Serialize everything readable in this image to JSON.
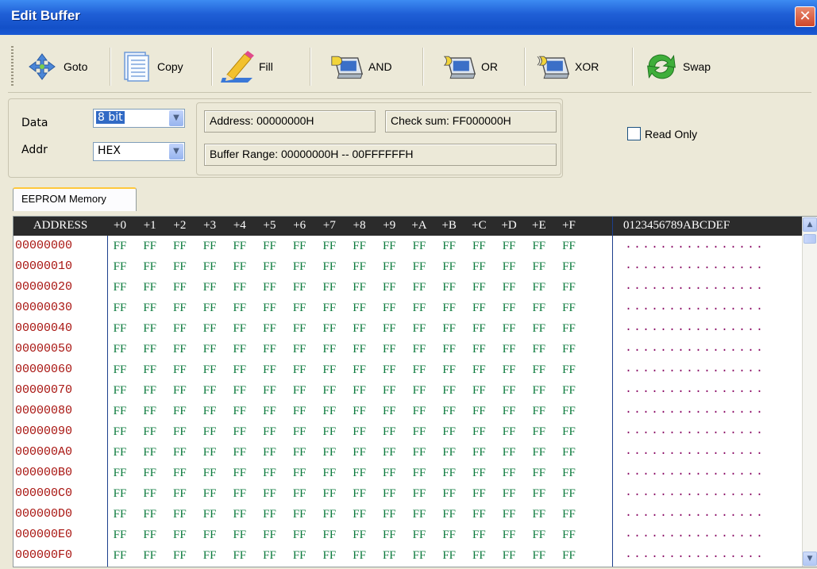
{
  "window": {
    "title": "Edit Buffer",
    "close_glyph": "✕"
  },
  "toolbar": {
    "buttons": [
      {
        "label": "Goto",
        "icon": "goto-arrows-icon"
      },
      {
        "label": "Copy",
        "icon": "copy-document-icon"
      },
      {
        "label": "Fill",
        "icon": "fill-pencil-icon"
      },
      {
        "label": "AND",
        "icon": "and-gate-icon"
      },
      {
        "label": "OR",
        "icon": "or-gate-icon"
      },
      {
        "label": "XOR",
        "icon": "xor-gate-icon"
      },
      {
        "label": "Swap",
        "icon": "swap-arrows-icon"
      }
    ]
  },
  "settings": {
    "data_label": "Data",
    "data_value": "8 bit",
    "addr_label": "Addr",
    "addr_value": "HEX",
    "address": "Address: 00000000H",
    "checksum": "Check sum: FF000000H",
    "buffer_range": "Buffer Range: 00000000H -- 00FFFFFFH",
    "read_only_label": "Read Only",
    "read_only_checked": false
  },
  "tab": {
    "label": "EEPROM Memory"
  },
  "grid": {
    "header_address": "ADDRESS",
    "columns": [
      "+0",
      "+1",
      "+2",
      "+3",
      "+4",
      "+5",
      "+6",
      "+7",
      "+8",
      "+9",
      "+A",
      "+B",
      "+C",
      "+D",
      "+E",
      "+F"
    ],
    "header_ascii": "0123456789ABCDEF",
    "rows": [
      {
        "address": "00000000",
        "bytes": [
          "FF",
          "FF",
          "FF",
          "FF",
          "FF",
          "FF",
          "FF",
          "FF",
          "FF",
          "FF",
          "FF",
          "FF",
          "FF",
          "FF",
          "FF",
          "FF"
        ],
        "ascii": "................"
      },
      {
        "address": "00000010",
        "bytes": [
          "FF",
          "FF",
          "FF",
          "FF",
          "FF",
          "FF",
          "FF",
          "FF",
          "FF",
          "FF",
          "FF",
          "FF",
          "FF",
          "FF",
          "FF",
          "FF"
        ],
        "ascii": "................"
      },
      {
        "address": "00000020",
        "bytes": [
          "FF",
          "FF",
          "FF",
          "FF",
          "FF",
          "FF",
          "FF",
          "FF",
          "FF",
          "FF",
          "FF",
          "FF",
          "FF",
          "FF",
          "FF",
          "FF"
        ],
        "ascii": "................"
      },
      {
        "address": "00000030",
        "bytes": [
          "FF",
          "FF",
          "FF",
          "FF",
          "FF",
          "FF",
          "FF",
          "FF",
          "FF",
          "FF",
          "FF",
          "FF",
          "FF",
          "FF",
          "FF",
          "FF"
        ],
        "ascii": "................"
      },
      {
        "address": "00000040",
        "bytes": [
          "FF",
          "FF",
          "FF",
          "FF",
          "FF",
          "FF",
          "FF",
          "FF",
          "FF",
          "FF",
          "FF",
          "FF",
          "FF",
          "FF",
          "FF",
          "FF"
        ],
        "ascii": "................"
      },
      {
        "address": "00000050",
        "bytes": [
          "FF",
          "FF",
          "FF",
          "FF",
          "FF",
          "FF",
          "FF",
          "FF",
          "FF",
          "FF",
          "FF",
          "FF",
          "FF",
          "FF",
          "FF",
          "FF"
        ],
        "ascii": "................"
      },
      {
        "address": "00000060",
        "bytes": [
          "FF",
          "FF",
          "FF",
          "FF",
          "FF",
          "FF",
          "FF",
          "FF",
          "FF",
          "FF",
          "FF",
          "FF",
          "FF",
          "FF",
          "FF",
          "FF"
        ],
        "ascii": "................"
      },
      {
        "address": "00000070",
        "bytes": [
          "FF",
          "FF",
          "FF",
          "FF",
          "FF",
          "FF",
          "FF",
          "FF",
          "FF",
          "FF",
          "FF",
          "FF",
          "FF",
          "FF",
          "FF",
          "FF"
        ],
        "ascii": "................"
      },
      {
        "address": "00000080",
        "bytes": [
          "FF",
          "FF",
          "FF",
          "FF",
          "FF",
          "FF",
          "FF",
          "FF",
          "FF",
          "FF",
          "FF",
          "FF",
          "FF",
          "FF",
          "FF",
          "FF"
        ],
        "ascii": "................"
      },
      {
        "address": "00000090",
        "bytes": [
          "FF",
          "FF",
          "FF",
          "FF",
          "FF",
          "FF",
          "FF",
          "FF",
          "FF",
          "FF",
          "FF",
          "FF",
          "FF",
          "FF",
          "FF",
          "FF"
        ],
        "ascii": "................"
      },
      {
        "address": "000000A0",
        "bytes": [
          "FF",
          "FF",
          "FF",
          "FF",
          "FF",
          "FF",
          "FF",
          "FF",
          "FF",
          "FF",
          "FF",
          "FF",
          "FF",
          "FF",
          "FF",
          "FF"
        ],
        "ascii": "................"
      },
      {
        "address": "000000B0",
        "bytes": [
          "FF",
          "FF",
          "FF",
          "FF",
          "FF",
          "FF",
          "FF",
          "FF",
          "FF",
          "FF",
          "FF",
          "FF",
          "FF",
          "FF",
          "FF",
          "FF"
        ],
        "ascii": "................"
      },
      {
        "address": "000000C0",
        "bytes": [
          "FF",
          "FF",
          "FF",
          "FF",
          "FF",
          "FF",
          "FF",
          "FF",
          "FF",
          "FF",
          "FF",
          "FF",
          "FF",
          "FF",
          "FF",
          "FF"
        ],
        "ascii": "................"
      },
      {
        "address": "000000D0",
        "bytes": [
          "FF",
          "FF",
          "FF",
          "FF",
          "FF",
          "FF",
          "FF",
          "FF",
          "FF",
          "FF",
          "FF",
          "FF",
          "FF",
          "FF",
          "FF",
          "FF"
        ],
        "ascii": "................"
      },
      {
        "address": "000000E0",
        "bytes": [
          "FF",
          "FF",
          "FF",
          "FF",
          "FF",
          "FF",
          "FF",
          "FF",
          "FF",
          "FF",
          "FF",
          "FF",
          "FF",
          "FF",
          "FF",
          "FF"
        ],
        "ascii": "................"
      },
      {
        "address": "000000F0",
        "bytes": [
          "FF",
          "FF",
          "FF",
          "FF",
          "FF",
          "FF",
          "FF",
          "FF",
          "FF",
          "FF",
          "FF",
          "FF",
          "FF",
          "FF",
          "FF",
          "FF"
        ],
        "ascii": "................"
      }
    ]
  },
  "colors": {
    "title_bar": "#1f5fd6",
    "header_bg": "#2b2b2b",
    "address_text": "#a81410",
    "byte_text": "#0b7a3c",
    "ascii_text": "#8a0a66",
    "selection": "#316ac5"
  }
}
